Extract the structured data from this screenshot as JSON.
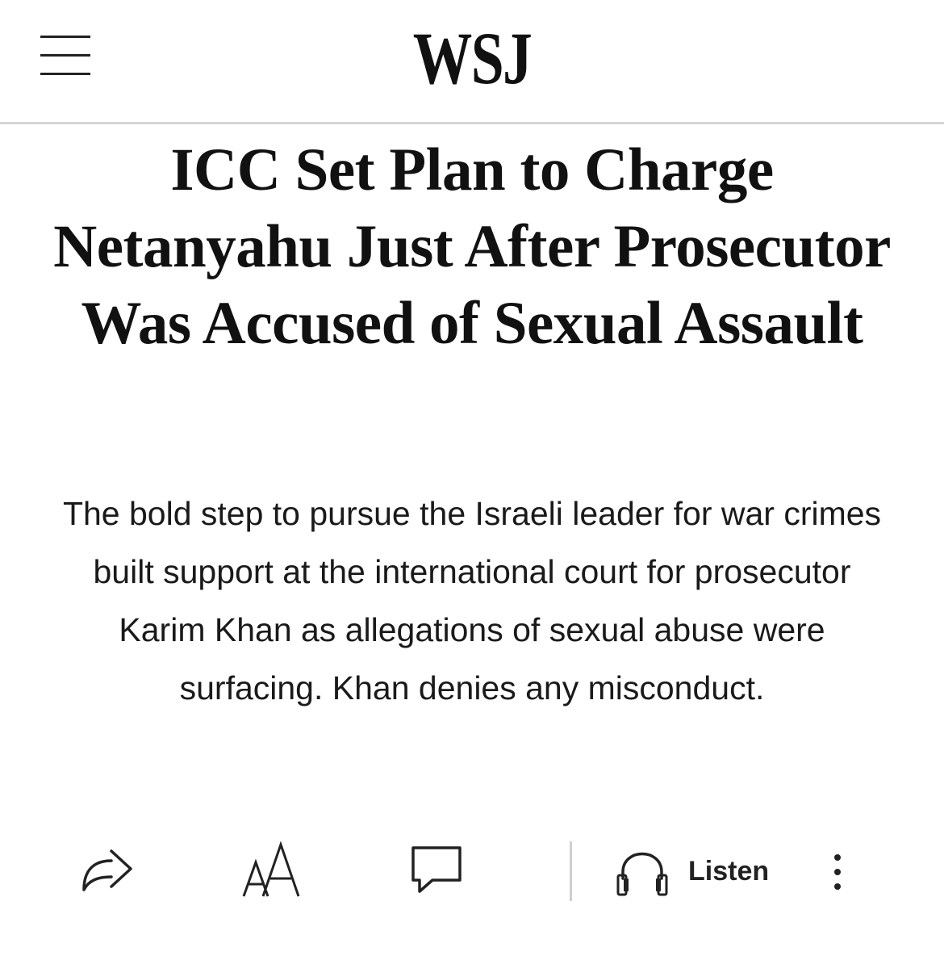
{
  "header": {
    "logo": "WSJ",
    "menu_icon": "hamburger-menu-icon"
  },
  "article": {
    "headline": "ICC Set Plan to Charge Netanyahu Just After Prosecutor Was Accused of Sexual Assault",
    "dek": "The bold step to pursue the Israeli leader for war crimes built support at the international court for prosecutor Karim Khan as allegations of sexual abuse were surfacing. Khan denies any misconduct."
  },
  "toolbar": {
    "share_icon": "share-arrow-icon",
    "text_size_icon": "text-size-icon",
    "comment_icon": "comment-bubble-icon",
    "listen_icon": "headphones-icon",
    "listen_label": "Listen",
    "more_icon": "more-vertical-icon"
  }
}
